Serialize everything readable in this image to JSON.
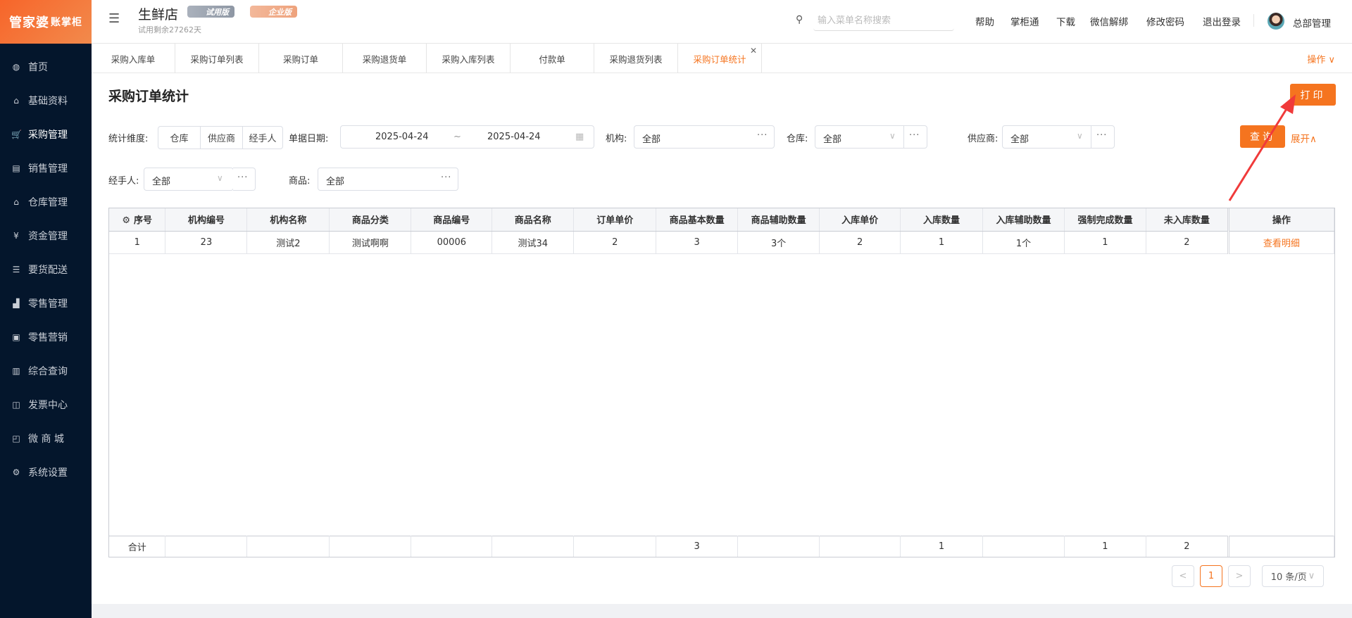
{
  "brand": {
    "logo_text": "管家婆",
    "logo_sub": "账掌柜"
  },
  "sidebar": {
    "items": [
      {
        "label": "首页",
        "icon": "globe-icon"
      },
      {
        "label": "基础资料",
        "icon": "home-icon"
      },
      {
        "label": "采购管理",
        "icon": "cart-icon"
      },
      {
        "label": "销售管理",
        "icon": "sales-icon"
      },
      {
        "label": "仓库管理",
        "icon": "warehouse-icon"
      },
      {
        "label": "资金管理",
        "icon": "money-icon"
      },
      {
        "label": "要货配送",
        "icon": "list-icon"
      },
      {
        "label": "零售管理",
        "icon": "chart-icon"
      },
      {
        "label": "零售营销",
        "icon": "gift-icon"
      },
      {
        "label": "综合查询",
        "icon": "bar-chart-icon"
      },
      {
        "label": "发票中心",
        "icon": "invoice-icon"
      },
      {
        "label": "微 商 城",
        "icon": "bag-icon"
      },
      {
        "label": "系统设置",
        "icon": "gear-icon"
      }
    ],
    "active": "采购管理"
  },
  "header": {
    "shop": "生鲜店",
    "badge_trial": "试用版",
    "badge_enterprise": "企业版",
    "trial_remaining": "试用剩余27262天",
    "search_placeholder": "输入菜单名称搜索",
    "links": [
      "帮助",
      "掌柜通",
      "下载",
      "微信解绑",
      "修改密码",
      "退出登录"
    ],
    "user": "总部管理"
  },
  "tabs": {
    "items": [
      "采购入库单",
      "采购订单列表",
      "采购订单",
      "采购退货单",
      "采购入库列表",
      "付款单",
      "采购退货列表",
      "采购订单统计"
    ],
    "active": "采购订单统计",
    "ops_label": "操作 ∨"
  },
  "page": {
    "title": "采购订单统计",
    "print_label": "打印"
  },
  "filters": {
    "dimension_label": "统计维度:",
    "dimensions": [
      "仓库",
      "供应商",
      "经手人"
    ],
    "date_label": "单据日期:",
    "date_from": "2025-04-24",
    "date_sep": "~",
    "date_to": "2025-04-24",
    "org_label": "机构:",
    "org_value": "全部",
    "warehouse_label": "仓库:",
    "warehouse_value": "全部",
    "supplier_label": "供应商:",
    "supplier_value": "全部",
    "handler_label": "经手人:",
    "handler_value": "全部",
    "product_label": "商品:",
    "product_value": "全部",
    "query_label": "查询",
    "expand_label": "展开∧"
  },
  "table": {
    "headers": [
      "序号",
      "机构编号",
      "机构名称",
      "商品分类",
      "商品编号",
      "商品名称",
      "订单单价",
      "商品基本数量",
      "商品辅助数量",
      "入库单价",
      "入库数量",
      "入库辅助数量",
      "强制完成数量",
      "未入库数量",
      "操作"
    ],
    "rows": [
      [
        "1",
        "23",
        "测试2",
        "测试啊啊",
        "00006",
        "测试34",
        "2",
        "3",
        "3个",
        "2",
        "1",
        "1个",
        "1",
        "2",
        "查看明细"
      ]
    ],
    "footer": [
      "合计",
      "",
      "",
      "",
      "",
      "",
      "",
      "3",
      "",
      "",
      "1",
      "",
      "1",
      "2",
      ""
    ]
  },
  "pagination": {
    "prev": "<",
    "current": "1",
    "next": ">",
    "page_size": "10 条/页"
  }
}
